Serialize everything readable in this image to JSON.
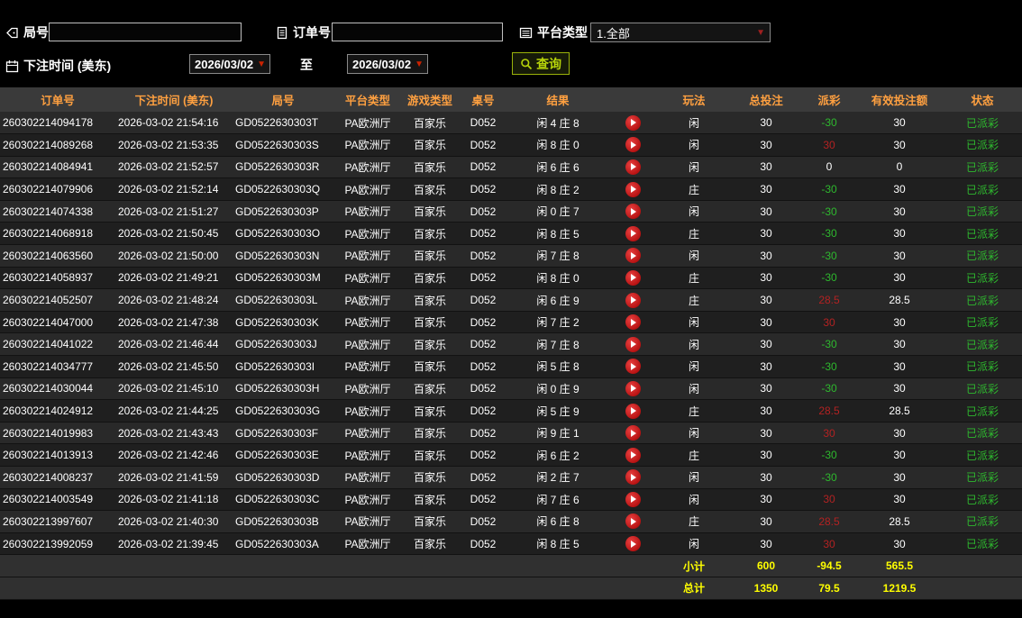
{
  "filters": {
    "round_label": "局号",
    "round_value": "",
    "order_label": "订单号",
    "order_value": "",
    "platform_label": "平台类型",
    "platform_value": "1.全部",
    "time_label": "下注时间 (美东)",
    "to_label": "至",
    "date_from": "2026/03/02",
    "date_to": "2026/03/02",
    "search_label": "查询"
  },
  "table": {
    "headers": [
      "订单号",
      "下注时间 (美东)",
      "局号",
      "平台类型",
      "游戏类型",
      "桌号",
      "结果",
      "",
      "玩法",
      "总投注",
      "派彩",
      "有效投注额",
      "状态"
    ],
    "columns": [
      "order",
      "time",
      "round",
      "platform",
      "game",
      "table_no",
      "result",
      "replay",
      "play",
      "bet",
      "payout",
      "valid",
      "status"
    ],
    "rows": [
      {
        "order": "260302214094178",
        "time": "2026-03-02 21:54:16",
        "round": "GD0522630303T",
        "platform": "PA欧洲厅",
        "game": "百家乐",
        "table_no": "D052",
        "result": "闲 4 庄 8",
        "play": "闲",
        "bet": "30",
        "payout": "-30",
        "valid": "30",
        "status": "已派彩"
      },
      {
        "order": "260302214089268",
        "time": "2026-03-02 21:53:35",
        "round": "GD0522630303S",
        "platform": "PA欧洲厅",
        "game": "百家乐",
        "table_no": "D052",
        "result": "闲 8 庄 0",
        "play": "闲",
        "bet": "30",
        "payout": "30",
        "valid": "30",
        "status": "已派彩"
      },
      {
        "order": "260302214084941",
        "time": "2026-03-02 21:52:57",
        "round": "GD0522630303R",
        "platform": "PA欧洲厅",
        "game": "百家乐",
        "table_no": "D052",
        "result": "闲 6 庄 6",
        "play": "闲",
        "bet": "30",
        "payout": "0",
        "valid": "0",
        "status": "已派彩"
      },
      {
        "order": "260302214079906",
        "time": "2026-03-02 21:52:14",
        "round": "GD0522630303Q",
        "platform": "PA欧洲厅",
        "game": "百家乐",
        "table_no": "D052",
        "result": "闲 8 庄 2",
        "play": "庄",
        "bet": "30",
        "payout": "-30",
        "valid": "30",
        "status": "已派彩"
      },
      {
        "order": "260302214074338",
        "time": "2026-03-02 21:51:27",
        "round": "GD0522630303P",
        "platform": "PA欧洲厅",
        "game": "百家乐",
        "table_no": "D052",
        "result": "闲 0 庄 7",
        "play": "闲",
        "bet": "30",
        "payout": "-30",
        "valid": "30",
        "status": "已派彩"
      },
      {
        "order": "260302214068918",
        "time": "2026-03-02 21:50:45",
        "round": "GD0522630303O",
        "platform": "PA欧洲厅",
        "game": "百家乐",
        "table_no": "D052",
        "result": "闲 8 庄 5",
        "play": "庄",
        "bet": "30",
        "payout": "-30",
        "valid": "30",
        "status": "已派彩"
      },
      {
        "order": "260302214063560",
        "time": "2026-03-02 21:50:00",
        "round": "GD0522630303N",
        "platform": "PA欧洲厅",
        "game": "百家乐",
        "table_no": "D052",
        "result": "闲 7 庄 8",
        "play": "闲",
        "bet": "30",
        "payout": "-30",
        "valid": "30",
        "status": "已派彩"
      },
      {
        "order": "260302214058937",
        "time": "2026-03-02 21:49:21",
        "round": "GD0522630303M",
        "platform": "PA欧洲厅",
        "game": "百家乐",
        "table_no": "D052",
        "result": "闲 8 庄 0",
        "play": "庄",
        "bet": "30",
        "payout": "-30",
        "valid": "30",
        "status": "已派彩"
      },
      {
        "order": "260302214052507",
        "time": "2026-03-02 21:48:24",
        "round": "GD0522630303L",
        "platform": "PA欧洲厅",
        "game": "百家乐",
        "table_no": "D052",
        "result": "闲 6 庄 9",
        "play": "庄",
        "bet": "30",
        "payout": "28.5",
        "valid": "28.5",
        "status": "已派彩"
      },
      {
        "order": "260302214047000",
        "time": "2026-03-02 21:47:38",
        "round": "GD0522630303K",
        "platform": "PA欧洲厅",
        "game": "百家乐",
        "table_no": "D052",
        "result": "闲 7 庄 2",
        "play": "闲",
        "bet": "30",
        "payout": "30",
        "valid": "30",
        "status": "已派彩"
      },
      {
        "order": "260302214041022",
        "time": "2026-03-02 21:46:44",
        "round": "GD0522630303J",
        "platform": "PA欧洲厅",
        "game": "百家乐",
        "table_no": "D052",
        "result": "闲 7 庄 8",
        "play": "闲",
        "bet": "30",
        "payout": "-30",
        "valid": "30",
        "status": "已派彩"
      },
      {
        "order": "260302214034777",
        "time": "2026-03-02 21:45:50",
        "round": "GD0522630303I",
        "platform": "PA欧洲厅",
        "game": "百家乐",
        "table_no": "D052",
        "result": "闲 5 庄 8",
        "play": "闲",
        "bet": "30",
        "payout": "-30",
        "valid": "30",
        "status": "已派彩"
      },
      {
        "order": "260302214030044",
        "time": "2026-03-02 21:45:10",
        "round": "GD0522630303H",
        "platform": "PA欧洲厅",
        "game": "百家乐",
        "table_no": "D052",
        "result": "闲 0 庄 9",
        "play": "闲",
        "bet": "30",
        "payout": "-30",
        "valid": "30",
        "status": "已派彩"
      },
      {
        "order": "260302214024912",
        "time": "2026-03-02 21:44:25",
        "round": "GD0522630303G",
        "platform": "PA欧洲厅",
        "game": "百家乐",
        "table_no": "D052",
        "result": "闲 5 庄 9",
        "play": "庄",
        "bet": "30",
        "payout": "28.5",
        "valid": "28.5",
        "status": "已派彩"
      },
      {
        "order": "260302214019983",
        "time": "2026-03-02 21:43:43",
        "round": "GD0522630303F",
        "platform": "PA欧洲厅",
        "game": "百家乐",
        "table_no": "D052",
        "result": "闲 9 庄 1",
        "play": "闲",
        "bet": "30",
        "payout": "30",
        "valid": "30",
        "status": "已派彩"
      },
      {
        "order": "260302214013913",
        "time": "2026-03-02 21:42:46",
        "round": "GD0522630303E",
        "platform": "PA欧洲厅",
        "game": "百家乐",
        "table_no": "D052",
        "result": "闲 6 庄 2",
        "play": "庄",
        "bet": "30",
        "payout": "-30",
        "valid": "30",
        "status": "已派彩"
      },
      {
        "order": "260302214008237",
        "time": "2026-03-02 21:41:59",
        "round": "GD0522630303D",
        "platform": "PA欧洲厅",
        "game": "百家乐",
        "table_no": "D052",
        "result": "闲 2 庄 7",
        "play": "闲",
        "bet": "30",
        "payout": "-30",
        "valid": "30",
        "status": "已派彩"
      },
      {
        "order": "260302214003549",
        "time": "2026-03-02 21:41:18",
        "round": "GD0522630303C",
        "platform": "PA欧洲厅",
        "game": "百家乐",
        "table_no": "D052",
        "result": "闲 7 庄 6",
        "play": "闲",
        "bet": "30",
        "payout": "30",
        "valid": "30",
        "status": "已派彩"
      },
      {
        "order": "260302213997607",
        "time": "2026-03-02 21:40:30",
        "round": "GD0522630303B",
        "platform": "PA欧洲厅",
        "game": "百家乐",
        "table_no": "D052",
        "result": "闲 6 庄 8",
        "play": "庄",
        "bet": "30",
        "payout": "28.5",
        "valid": "28.5",
        "status": "已派彩"
      },
      {
        "order": "260302213992059",
        "time": "2026-03-02 21:39:45",
        "round": "GD0522630303A",
        "platform": "PA欧洲厅",
        "game": "百家乐",
        "table_no": "D052",
        "result": "闲 8 庄 5",
        "play": "闲",
        "bet": "30",
        "payout": "30",
        "valid": "30",
        "status": "已派彩"
      }
    ],
    "footer": [
      {
        "label": "小计",
        "bet": "600",
        "payout": "-94.5",
        "valid": "565.5"
      },
      {
        "label": "总计",
        "bet": "1350",
        "payout": "79.5",
        "valid": "1219.5"
      }
    ]
  },
  "colors": {
    "header_text": "#ffa040",
    "payout_win_red": "#b22222",
    "payout_loss_green": "#2eb82e",
    "status_paid_green": "#2eb82e",
    "footer_yellow": "#ffff00",
    "search_accent": "#b7d40a",
    "replay_red": "#cc0000",
    "date_arrow_red": "#cc2200"
  }
}
